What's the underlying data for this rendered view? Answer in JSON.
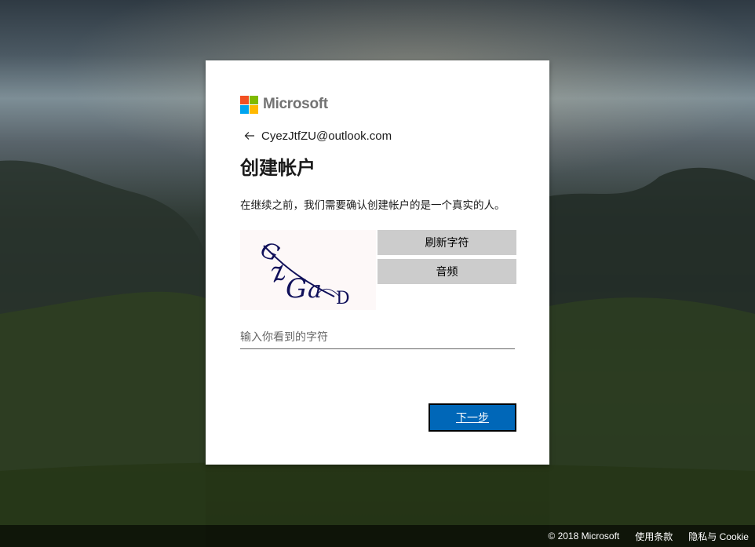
{
  "brand": {
    "name": "Microsoft",
    "logo_colors": [
      "#f25022",
      "#7fba00",
      "#00a4ef",
      "#ffb900"
    ]
  },
  "identity": {
    "email": "CyezJtfZU@outlook.com",
    "back_icon": "arrow-left-icon"
  },
  "page": {
    "title": "创建帐户",
    "description": "在继续之前，我们需要确认创建帐户的是一个真实的人。"
  },
  "captcha": {
    "text": "GzGaD",
    "refresh_label": "刷新字符",
    "audio_label": "音频",
    "input_placeholder": "输入你看到的字符",
    "input_value": ""
  },
  "actions": {
    "next_label": "下一步",
    "accent_color": "#0067b8"
  },
  "footer": {
    "copyright": "© 2018 Microsoft",
    "terms": "使用条款",
    "privacy": "隐私与 Cookie"
  }
}
